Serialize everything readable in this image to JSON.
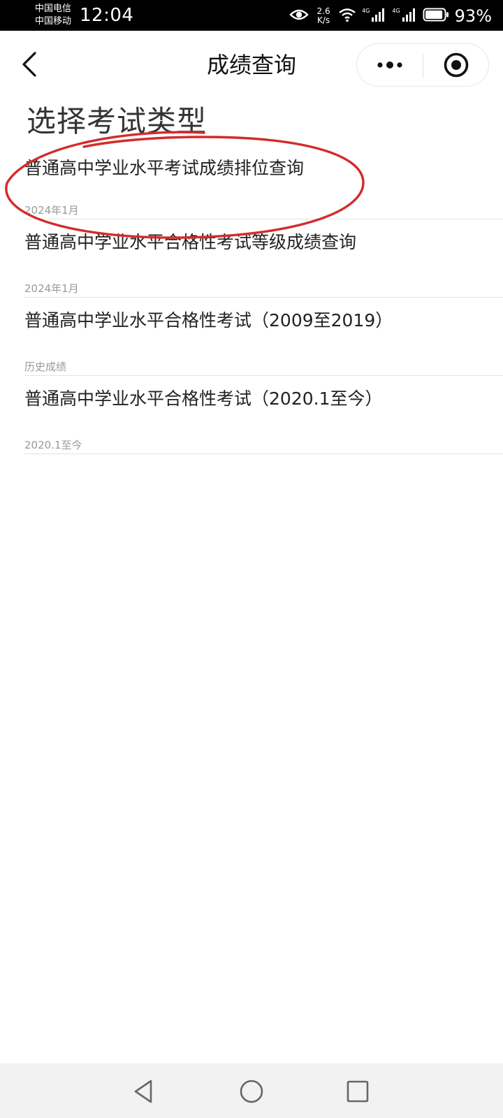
{
  "status_bar": {
    "carrier_1": "中国电信",
    "carrier_2": "中国移动",
    "time": "12:04",
    "speed_value": "2.6",
    "speed_unit": "K/s",
    "net_1": "4G",
    "net_2": "4G",
    "battery_percent": "93%",
    "battery_level": 0.93
  },
  "nav": {
    "title": "成绩查询"
  },
  "page": {
    "section_title": "选择考试类型",
    "items": [
      {
        "title": "普通高中学业水平考试成绩排位查询",
        "subtitle": "2024年1月"
      },
      {
        "title": "普通高中学业水平合格性考试等级成绩查询",
        "subtitle": "2024年1月"
      },
      {
        "title": "普通高中学业水平合格性考试（2009至2019）",
        "subtitle": "历史成绩"
      },
      {
        "title": "普通高中学业水平合格性考试（2020.1至今）",
        "subtitle": "2020.1至今"
      }
    ]
  },
  "colors": {
    "annotation": "#d42b2b",
    "status_bar_bg": "#000000",
    "bottom_nav_bg": "#f2f2f2"
  }
}
